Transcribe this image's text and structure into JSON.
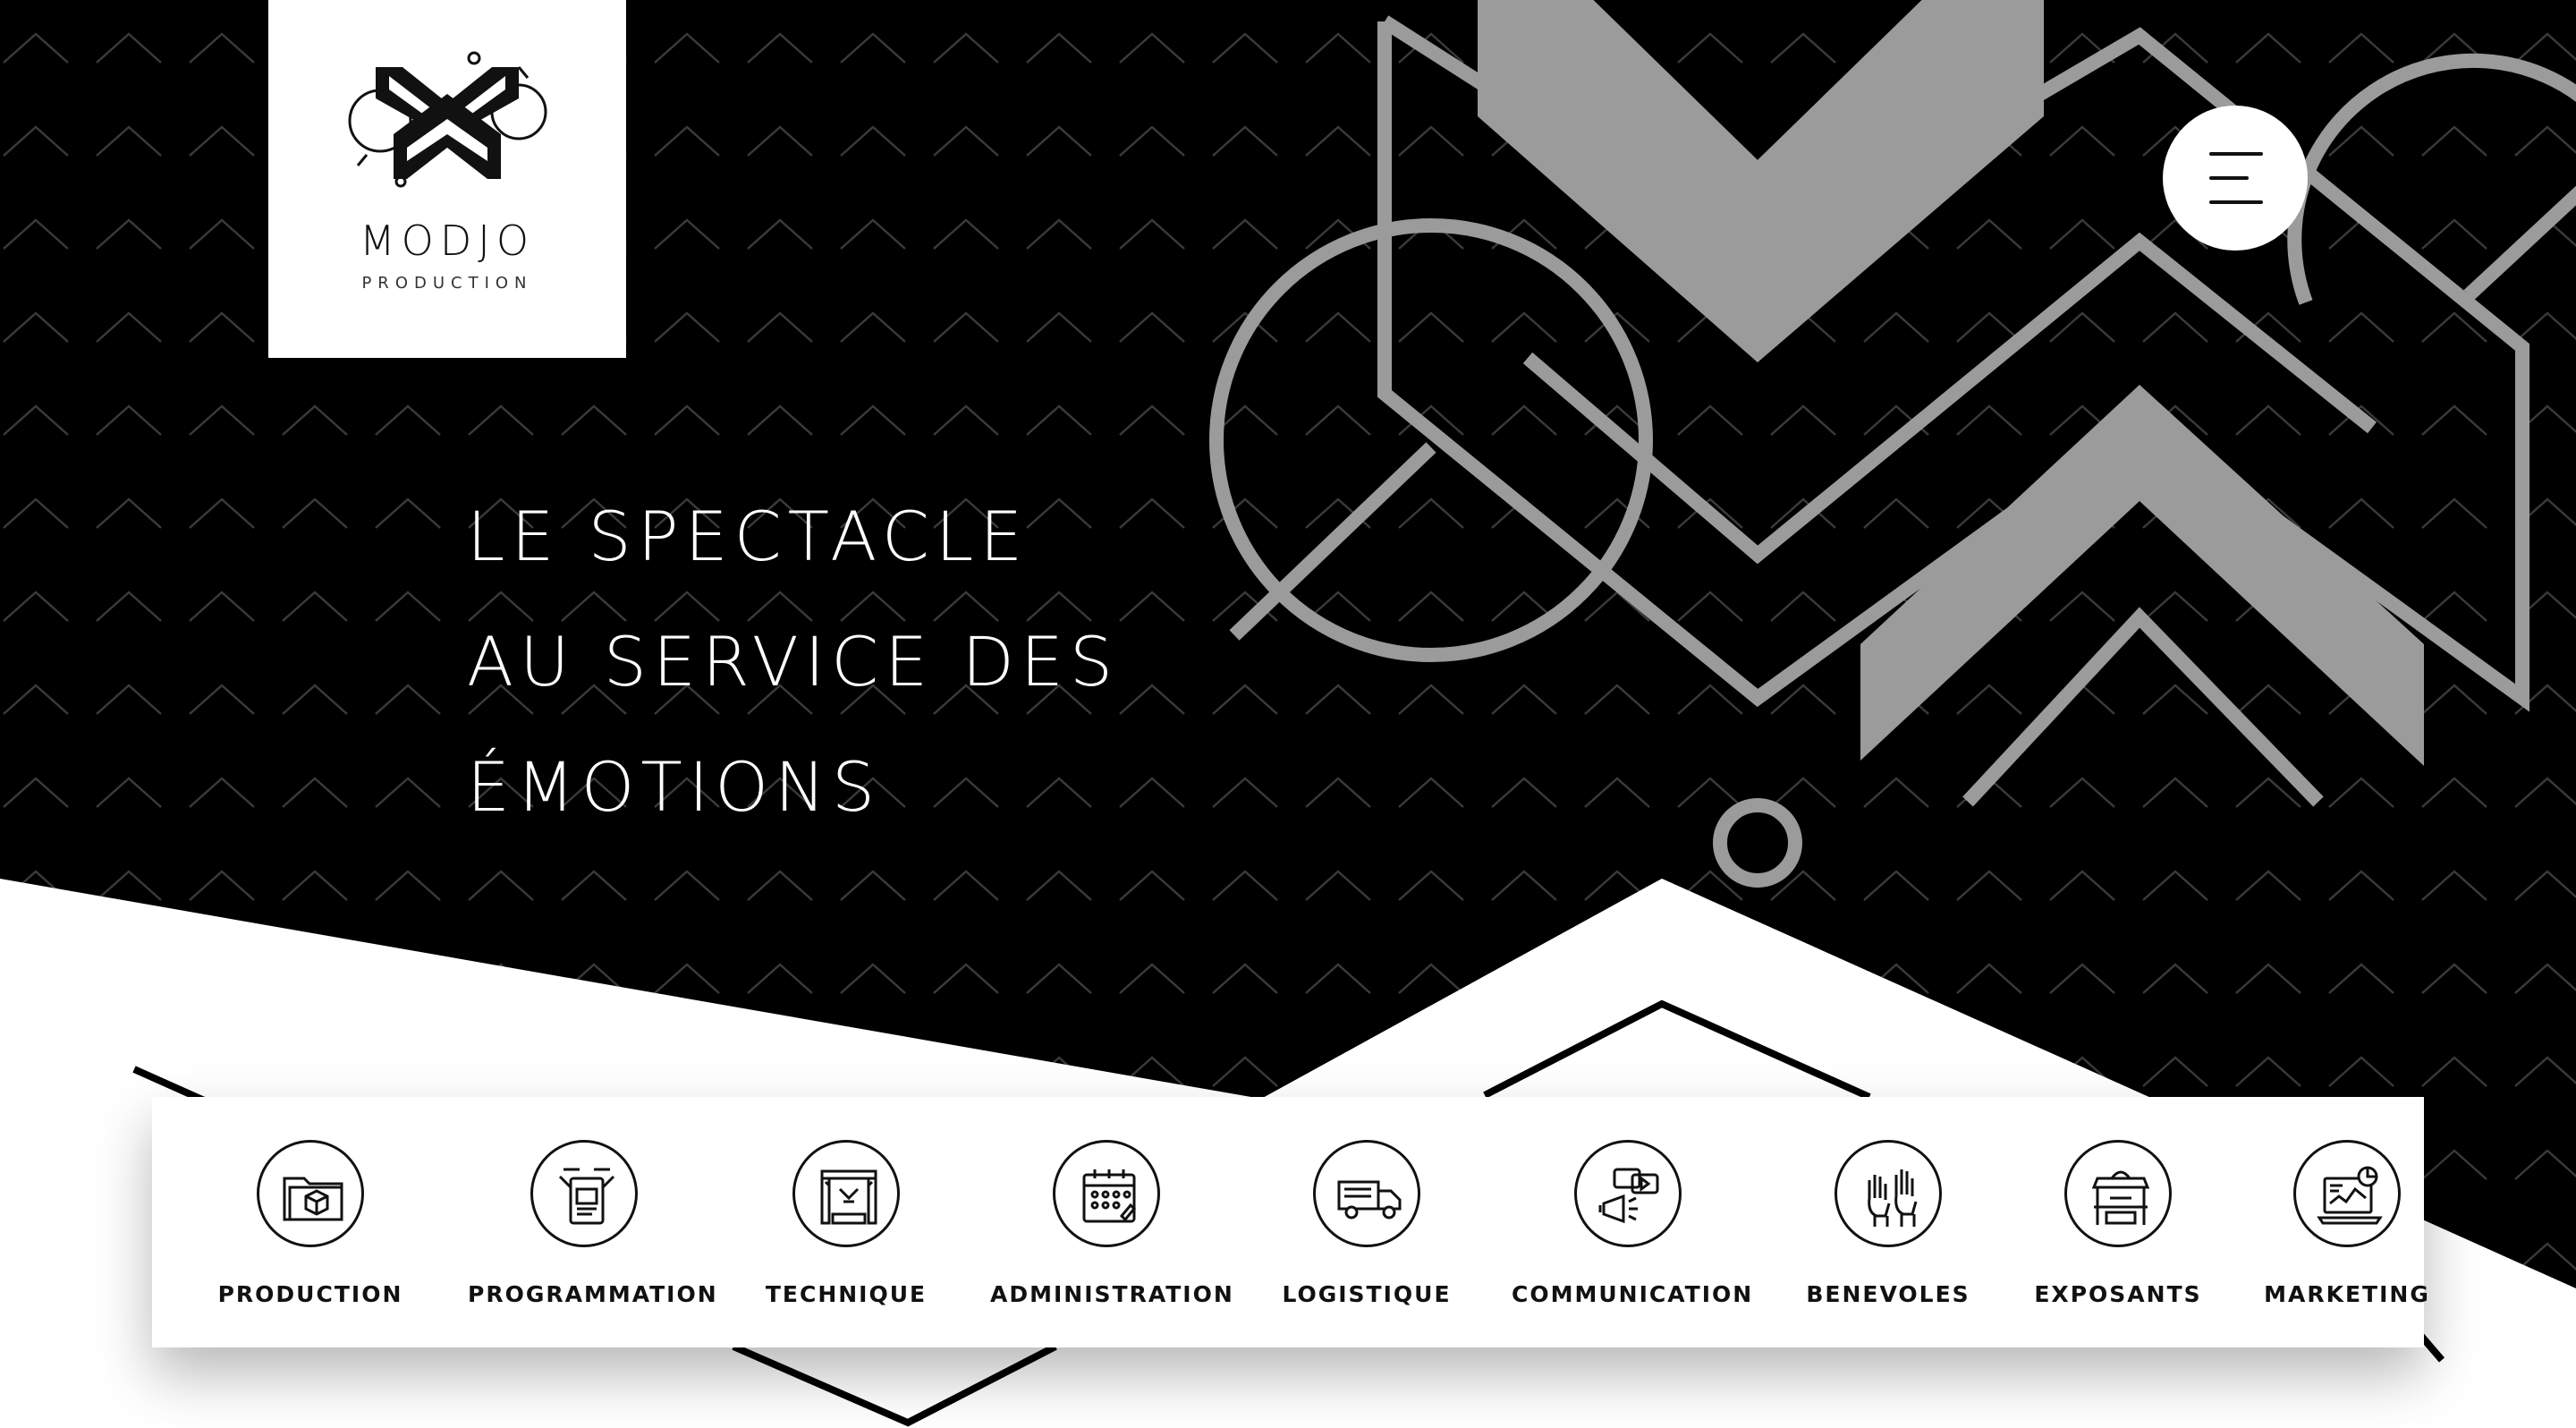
{
  "brand": {
    "name": "MODJO",
    "subtitle": "PRODUCTION"
  },
  "menu": {
    "icon": "hamburger-menu-icon"
  },
  "hero": {
    "lines": [
      "LE SPECTACLE",
      "AU SERVICE DES",
      "ÉMOTIONS"
    ]
  },
  "services": [
    {
      "label": "PRODUCTION",
      "icon": "folder-box-icon"
    },
    {
      "label": "PROGRAMMATION",
      "icon": "tablet-contract-icon"
    },
    {
      "label": "TECHNIQUE",
      "icon": "stage-truss-icon"
    },
    {
      "label": "ADMINISTRATION",
      "icon": "calendar-icon"
    },
    {
      "label": "LOGISTIQUE",
      "icon": "truck-icon"
    },
    {
      "label": "COMMUNICATION",
      "icon": "megaphone-chat-icon"
    },
    {
      "label": "BENEVOLES",
      "icon": "raised-hands-icon"
    },
    {
      "label": "EXPOSANTS",
      "icon": "food-stand-icon"
    },
    {
      "label": "MARKETING",
      "icon": "laptop-chart-icon"
    }
  ],
  "colors": {
    "background_dark": "#000000",
    "pattern_line": "#3a3a3a",
    "shape_gray": "#9b9b9b",
    "white": "#ffffff",
    "text_dark": "#111111"
  }
}
